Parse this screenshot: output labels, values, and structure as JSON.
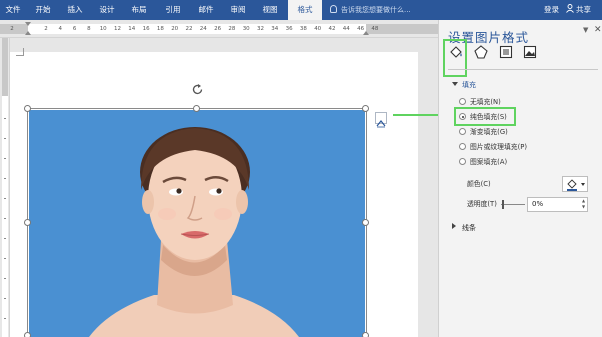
{
  "ribbon": {
    "tabs": [
      {
        "label": "文件",
        "active": false
      },
      {
        "label": "开始",
        "active": false
      },
      {
        "label": "插入",
        "active": false
      },
      {
        "label": "设计",
        "active": false
      },
      {
        "label": "布局",
        "active": false
      },
      {
        "label": "引用",
        "active": false
      },
      {
        "label": "邮件",
        "active": false
      },
      {
        "label": "审阅",
        "active": false
      },
      {
        "label": "视图",
        "active": false
      },
      {
        "label": "格式",
        "active": true
      }
    ],
    "tell_me": "告诉我您想要做什么...",
    "login": "登录",
    "share": "共享"
  },
  "ruler": {
    "numbers": [
      "2",
      "2",
      "4",
      "6",
      "8",
      "10",
      "12",
      "14",
      "16",
      "18",
      "20",
      "22",
      "24",
      "26",
      "28",
      "30",
      "32",
      "34",
      "36",
      "38",
      "40",
      "42",
      "44",
      "46",
      "48"
    ]
  },
  "format_pane": {
    "title": "设置图片格式",
    "tools": [
      "fill-line-icon",
      "effects-icon",
      "layout-properties-icon",
      "picture-icon"
    ],
    "fill_section": {
      "header": "填充",
      "options": [
        {
          "label": "无填充(N)",
          "selected": false
        },
        {
          "label": "纯色填充(S)",
          "selected": true
        },
        {
          "label": "渐变填充(G)",
          "selected": false
        },
        {
          "label": "图片或纹理填充(P)",
          "selected": false
        },
        {
          "label": "图案填充(A)",
          "selected": false
        }
      ],
      "color_label": "颜色(C)",
      "transparency_label": "透明度(T)",
      "transparency_value": "0%"
    },
    "line_section": {
      "header": "线条"
    }
  },
  "colors": {
    "ribbon": "#2b579a",
    "picture_background": "#4a90d2",
    "highlight": "#5fd35f"
  }
}
